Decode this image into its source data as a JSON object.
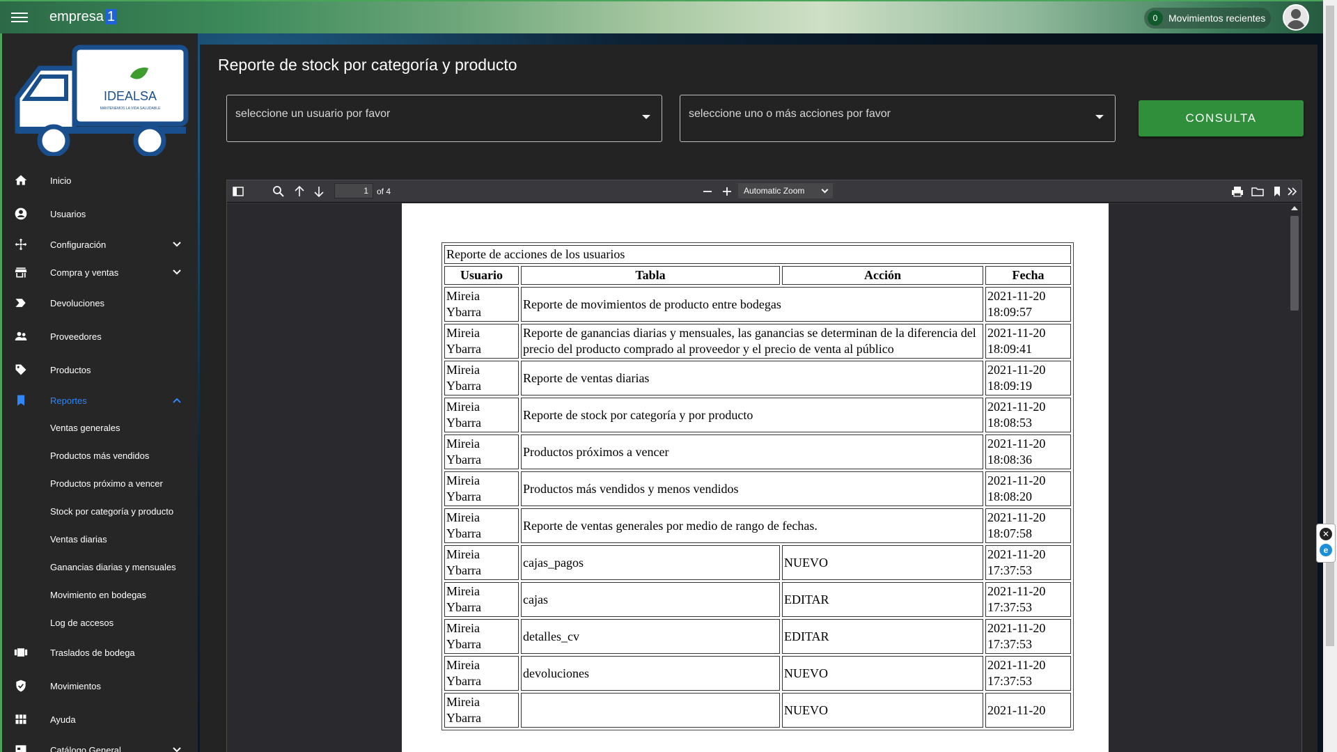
{
  "topbar": {
    "brand": "empresa",
    "brand_number": "1",
    "recent_count": "0",
    "recent_label": "Movimientos recientes"
  },
  "sidebar": {
    "items": [
      {
        "label": "Inicio",
        "icon": "home-icon"
      },
      {
        "label": "Usuarios",
        "icon": "account-circle-icon"
      },
      {
        "label": "Configuración",
        "icon": "move-arrows-icon",
        "expandable": true
      },
      {
        "label": "Compra y ventas",
        "icon": "store-icon",
        "expandable": true
      },
      {
        "label": "Devoluciones",
        "icon": "label-arrow-icon"
      },
      {
        "label": "Proveedores",
        "icon": "people-icon"
      },
      {
        "label": "Productos",
        "icon": "tag-icon"
      },
      {
        "label": "Reportes",
        "icon": "bookmark-icon",
        "expanded": true,
        "active": true
      },
      {
        "label": "Traslados de bodega",
        "icon": "view-carousel-icon"
      },
      {
        "label": "Movimientos",
        "icon": "shield-check-icon"
      },
      {
        "label": "Ayuda",
        "icon": "grid-icon"
      },
      {
        "label": "Catálogo General",
        "icon": "catalog-icon",
        "expandable": true
      }
    ],
    "reportes_sub": [
      "Ventas generales",
      "Productos más vendidos",
      "Productos próximo a vencer",
      "Stock por categoría y producto",
      "Ventas diarias",
      "Ganancias diarias y mensuales",
      "Movimiento en bodegas",
      "Log de accesos"
    ],
    "logo_text": "IDEALSA",
    "logo_tagline": "MANTENEMOS LA VIDA SALUDABLE"
  },
  "main": {
    "title": "Reporte de stock por categoría y producto",
    "user_select_placeholder": "seleccione un usuario por favor",
    "action_select_placeholder": "seleccione uno o más acciones por favor",
    "consulta_label": "CONSULTA"
  },
  "pdf_viewer": {
    "page_number": "1",
    "page_count": "of 4",
    "zoom": "Automatic Zoom"
  },
  "report": {
    "title": "Reporte de acciones de los usuarios",
    "headers": [
      "Usuario",
      "Tabla",
      "Acción",
      "Fecha"
    ],
    "rows": [
      {
        "usuario": "Mireia Ybarra",
        "tabla": "Reporte de movimientos de producto entre bodegas",
        "accion": "",
        "fecha": "2021-11-20 18:09:57"
      },
      {
        "usuario": "Mireia Ybarra",
        "tabla": "Reporte de ganancias diarias y mensuales, las ganancias se determinan de la diferencia del precio del producto comprado al proveedor y el precio de venta al público",
        "accion": "",
        "fecha": "2021-11-20 18:09:41"
      },
      {
        "usuario": "Mireia Ybarra",
        "tabla": "Reporte de ventas diarias",
        "accion": "",
        "fecha": "2021-11-20 18:09:19"
      },
      {
        "usuario": "Mireia Ybarra",
        "tabla": "Reporte de stock por categoría y por producto",
        "accion": "",
        "fecha": "2021-11-20 18:08:53"
      },
      {
        "usuario": "Mireia Ybarra",
        "tabla": "Productos próximos a vencer",
        "accion": "",
        "fecha": "2021-11-20 18:08:36"
      },
      {
        "usuario": "Mireia Ybarra",
        "tabla": "Productos más vendidos y menos vendidos",
        "accion": "",
        "fecha": "2021-11-20 18:08:20"
      },
      {
        "usuario": "Mireia Ybarra",
        "tabla": "Reporte de ventas generales por medio de rango de fechas.",
        "accion": "",
        "fecha": "2021-11-20 18:07:58"
      },
      {
        "usuario": "Mireia Ybarra",
        "tabla": "cajas_pagos",
        "accion": "NUEVO",
        "fecha": "2021-11-20 17:37:53"
      },
      {
        "usuario": "Mireia Ybarra",
        "tabla": "cajas",
        "accion": "EDITAR",
        "fecha": "2021-11-20 17:37:53"
      },
      {
        "usuario": "Mireia Ybarra",
        "tabla": "detalles_cv",
        "accion": "EDITAR",
        "fecha": "2021-11-20 17:37:53"
      },
      {
        "usuario": "Mireia Ybarra",
        "tabla": "devoluciones",
        "accion": "NUEVO",
        "fecha": "2021-11-20 17:37:53"
      },
      {
        "usuario": "Mireia Ybarra",
        "tabla": "",
        "accion": "NUEVO",
        "fecha": "2021-11-20"
      }
    ]
  },
  "colors": {
    "accent_green": "#2f8f3a",
    "active_blue": "#2f86f6",
    "sidebar_bg": "#262626",
    "main_bg": "#232323"
  }
}
